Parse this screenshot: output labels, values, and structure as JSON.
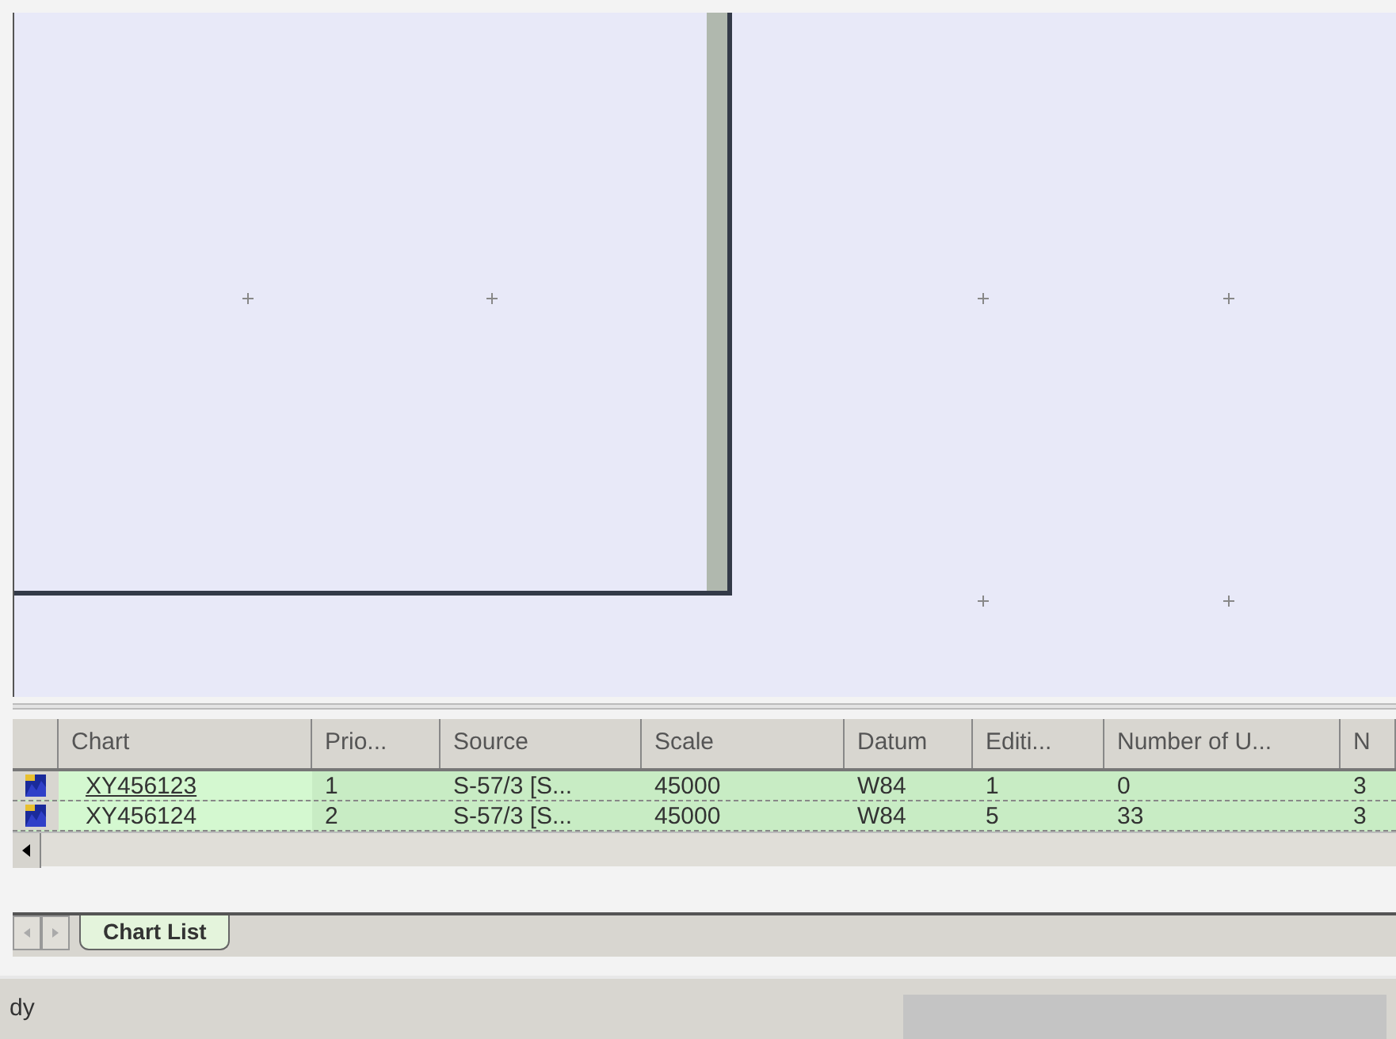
{
  "table": {
    "columns": [
      "Chart",
      "Prio...",
      "Source",
      "Scale",
      "Datum",
      "Editi...",
      "Number of U...",
      "N"
    ],
    "rows": [
      {
        "focused": true,
        "cells": [
          "XY456123",
          "1",
          "S-57/3 [S...",
          "45000",
          "W84",
          "1",
          "0",
          "3"
        ]
      },
      {
        "focused": false,
        "cells": [
          "XY456124",
          "2",
          "S-57/3 [S...",
          "45000",
          "W84",
          "5",
          "33",
          "3"
        ]
      }
    ]
  },
  "sheet_tabs": [
    {
      "label": "Chart List",
      "selected": true
    }
  ],
  "status_bar": {
    "text": "dy"
  }
}
